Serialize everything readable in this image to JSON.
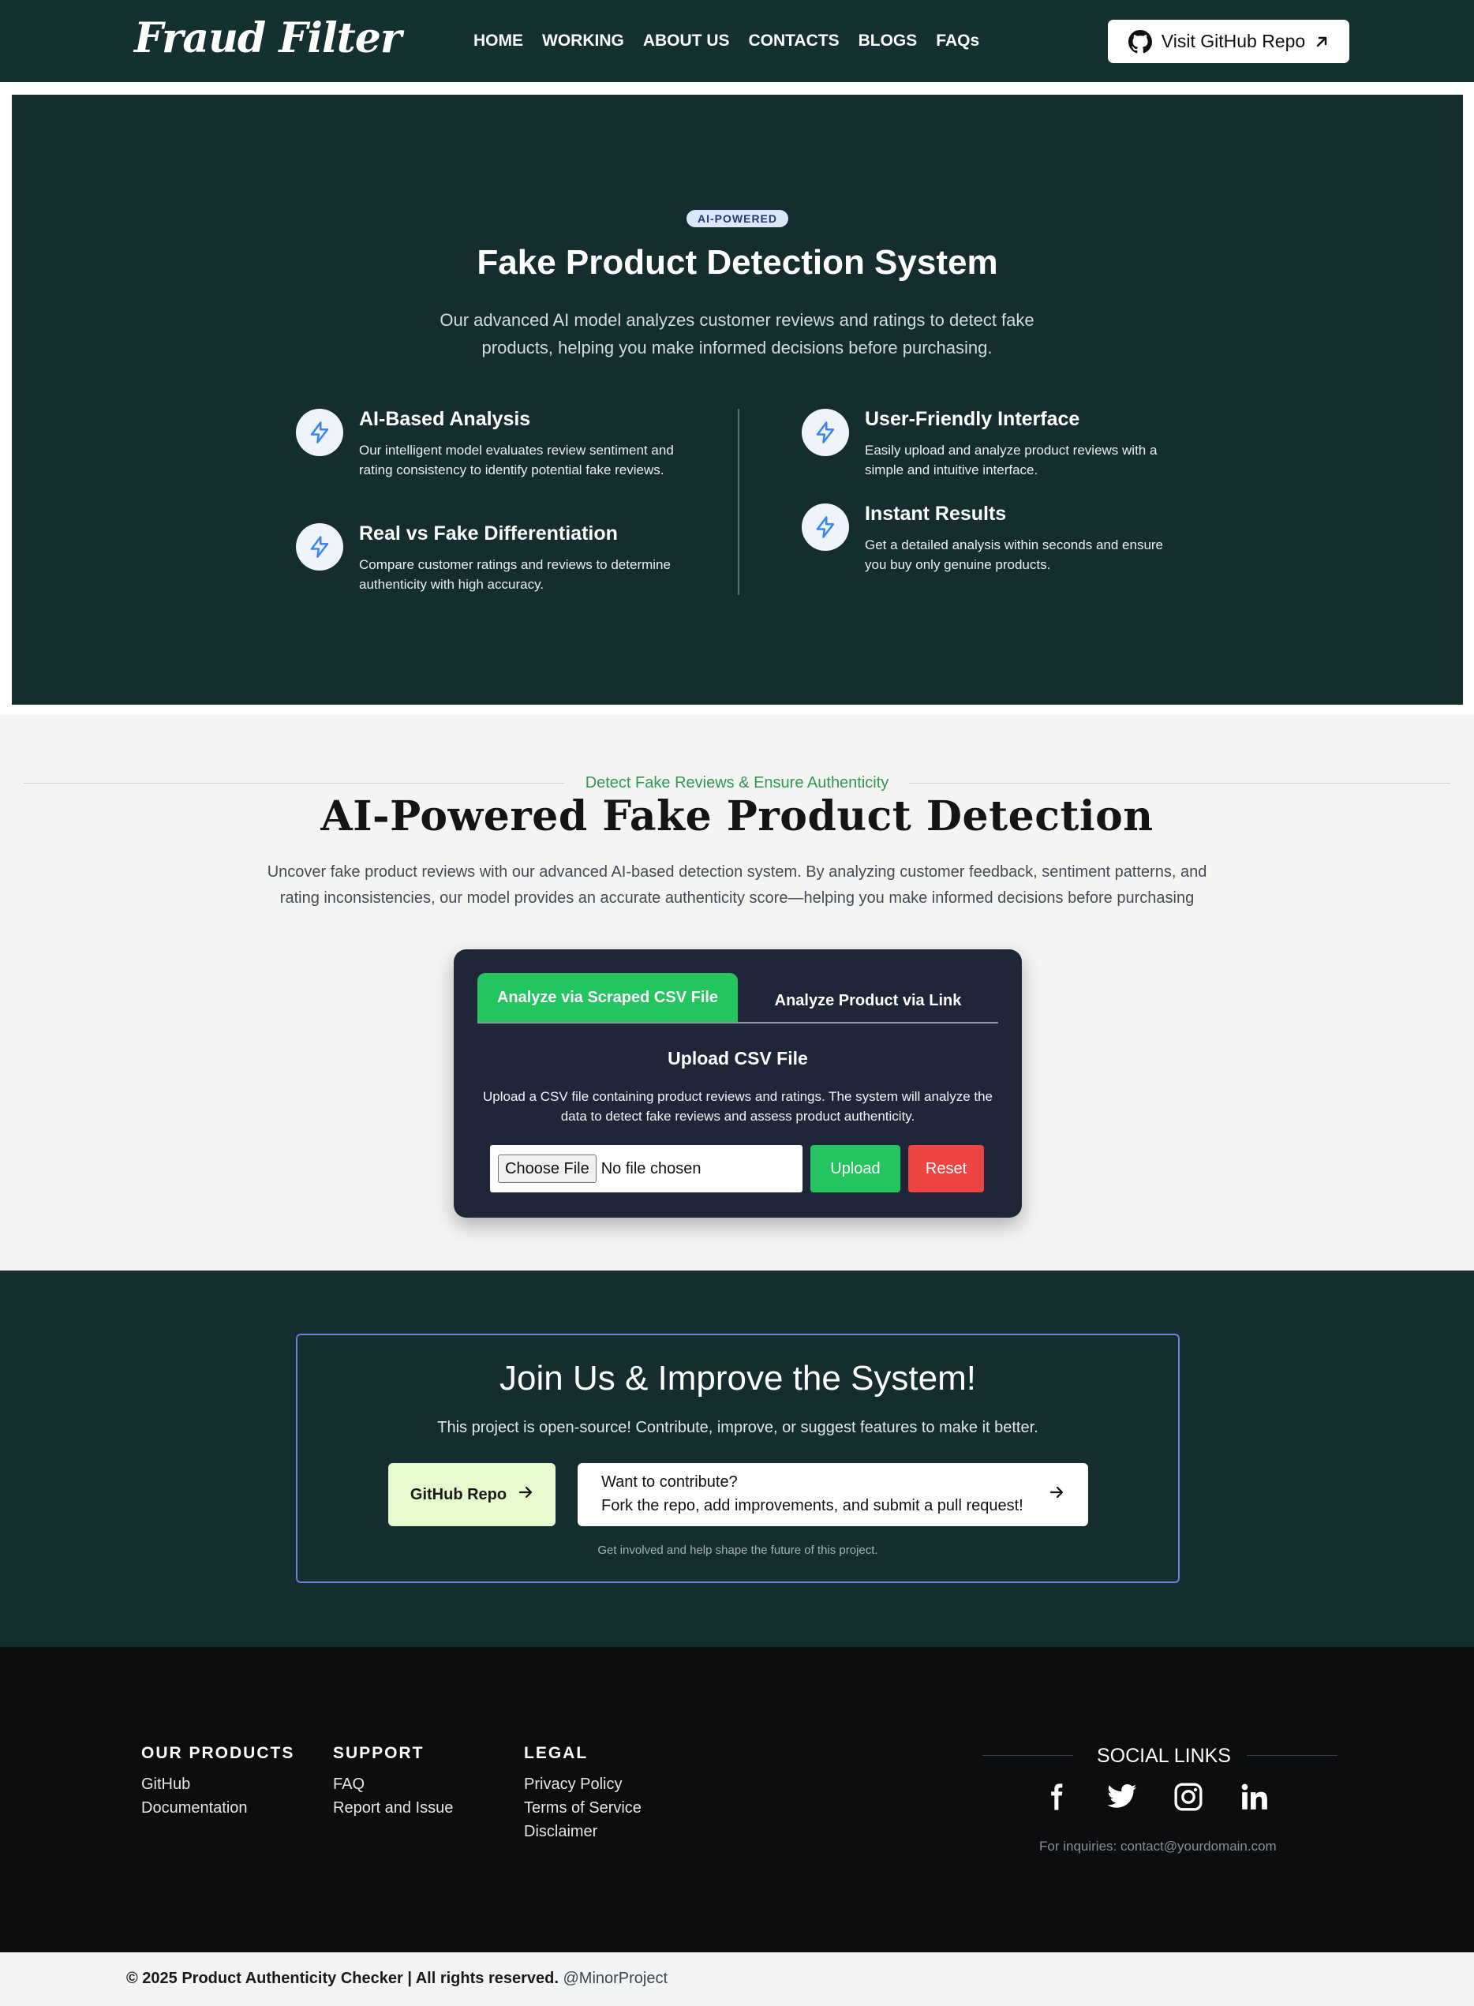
{
  "nav": {
    "logo": "Fraud Filter",
    "links": [
      "HOME",
      "WORKING",
      "ABOUT US",
      "CONTACTS",
      "BLOGS",
      "FAQs"
    ],
    "github_button": "Visit GitHub Repo"
  },
  "hero": {
    "badge": "AI-POWERED",
    "title": "Fake Product Detection System",
    "subtitle": "Our advanced AI model analyzes customer reviews and ratings to detect fake products, helping you make informed decisions before purchasing.",
    "features": [
      {
        "title": "AI-Based Analysis",
        "desc": "Our intelligent model evaluates review sentiment and rating consistency to identify potential fake reviews.",
        "icon": "lightning-icon"
      },
      {
        "title": "Real vs Fake Differentiation",
        "desc": "Compare customer ratings and reviews to determine authenticity with high accuracy.",
        "icon": "lightning-icon"
      },
      {
        "title": "User-Friendly Interface",
        "desc": "Easily upload and analyze product reviews with a simple and intuitive interface.",
        "icon": "lightning-icon"
      },
      {
        "title": "Instant Results",
        "desc": "Get a detailed analysis within seconds and ensure you buy only genuine products.",
        "icon": "lightning-icon"
      }
    ]
  },
  "detection": {
    "eyebrow": "Detect Fake Reviews & Ensure Authenticity",
    "title": "AI-Powered Fake Product Detection",
    "subtitle": "Uncover fake product reviews with our advanced AI-based detection system. By analyzing customer feedback, sentiment patterns, and rating inconsistencies, our model provides an accurate authenticity score—helping you make informed decisions before purchasing",
    "tabs": [
      "Analyze via Scraped CSV File",
      "Analyze Product via Link"
    ],
    "upload_title": "Upload CSV File",
    "upload_desc": "Upload a CSV file containing product reviews and ratings. The system will analyze the data to detect fake reviews and assess product authenticity.",
    "choose_file": "Choose File",
    "file_status": "No file chosen",
    "upload_button": "Upload",
    "reset_button": "Reset"
  },
  "join": {
    "title": "Join Us & Improve the System!",
    "subtitle": "This project is open-source! Contribute, improve, or suggest features to make it better.",
    "github_button": "GitHub Repo",
    "contribute_line1": "Want to contribute?",
    "contribute_line2": "Fork the repo, add improvements, and submit a pull request!",
    "footnote": "Get involved and help shape the future of this project."
  },
  "footer": {
    "columns": [
      {
        "heading": "OUR PRODUCTS",
        "links": [
          "GitHub",
          "Documentation"
        ]
      },
      {
        "heading": "SUPPORT",
        "links": [
          "FAQ",
          "Report and Issue"
        ]
      },
      {
        "heading": "LEGAL",
        "links": [
          "Privacy Policy",
          "Terms of Service",
          "Disclaimer"
        ]
      }
    ],
    "social_title": "SOCIAL LINKS",
    "social_icons": [
      "facebook-icon",
      "twitter-icon",
      "instagram-icon",
      "linkedin-icon"
    ],
    "inquiry": "For inquiries: contact@yourdomain.com"
  },
  "bottom": {
    "copyright": "© 2025 Product Authenticity Checker | All rights reserved.",
    "handle": "@MinorProject"
  },
  "colors": {
    "dark_teal": "#152d2e",
    "green": "#22c55e",
    "red": "#ef4444",
    "panel": "#1f2638",
    "join_border": "#6b7fdc"
  }
}
